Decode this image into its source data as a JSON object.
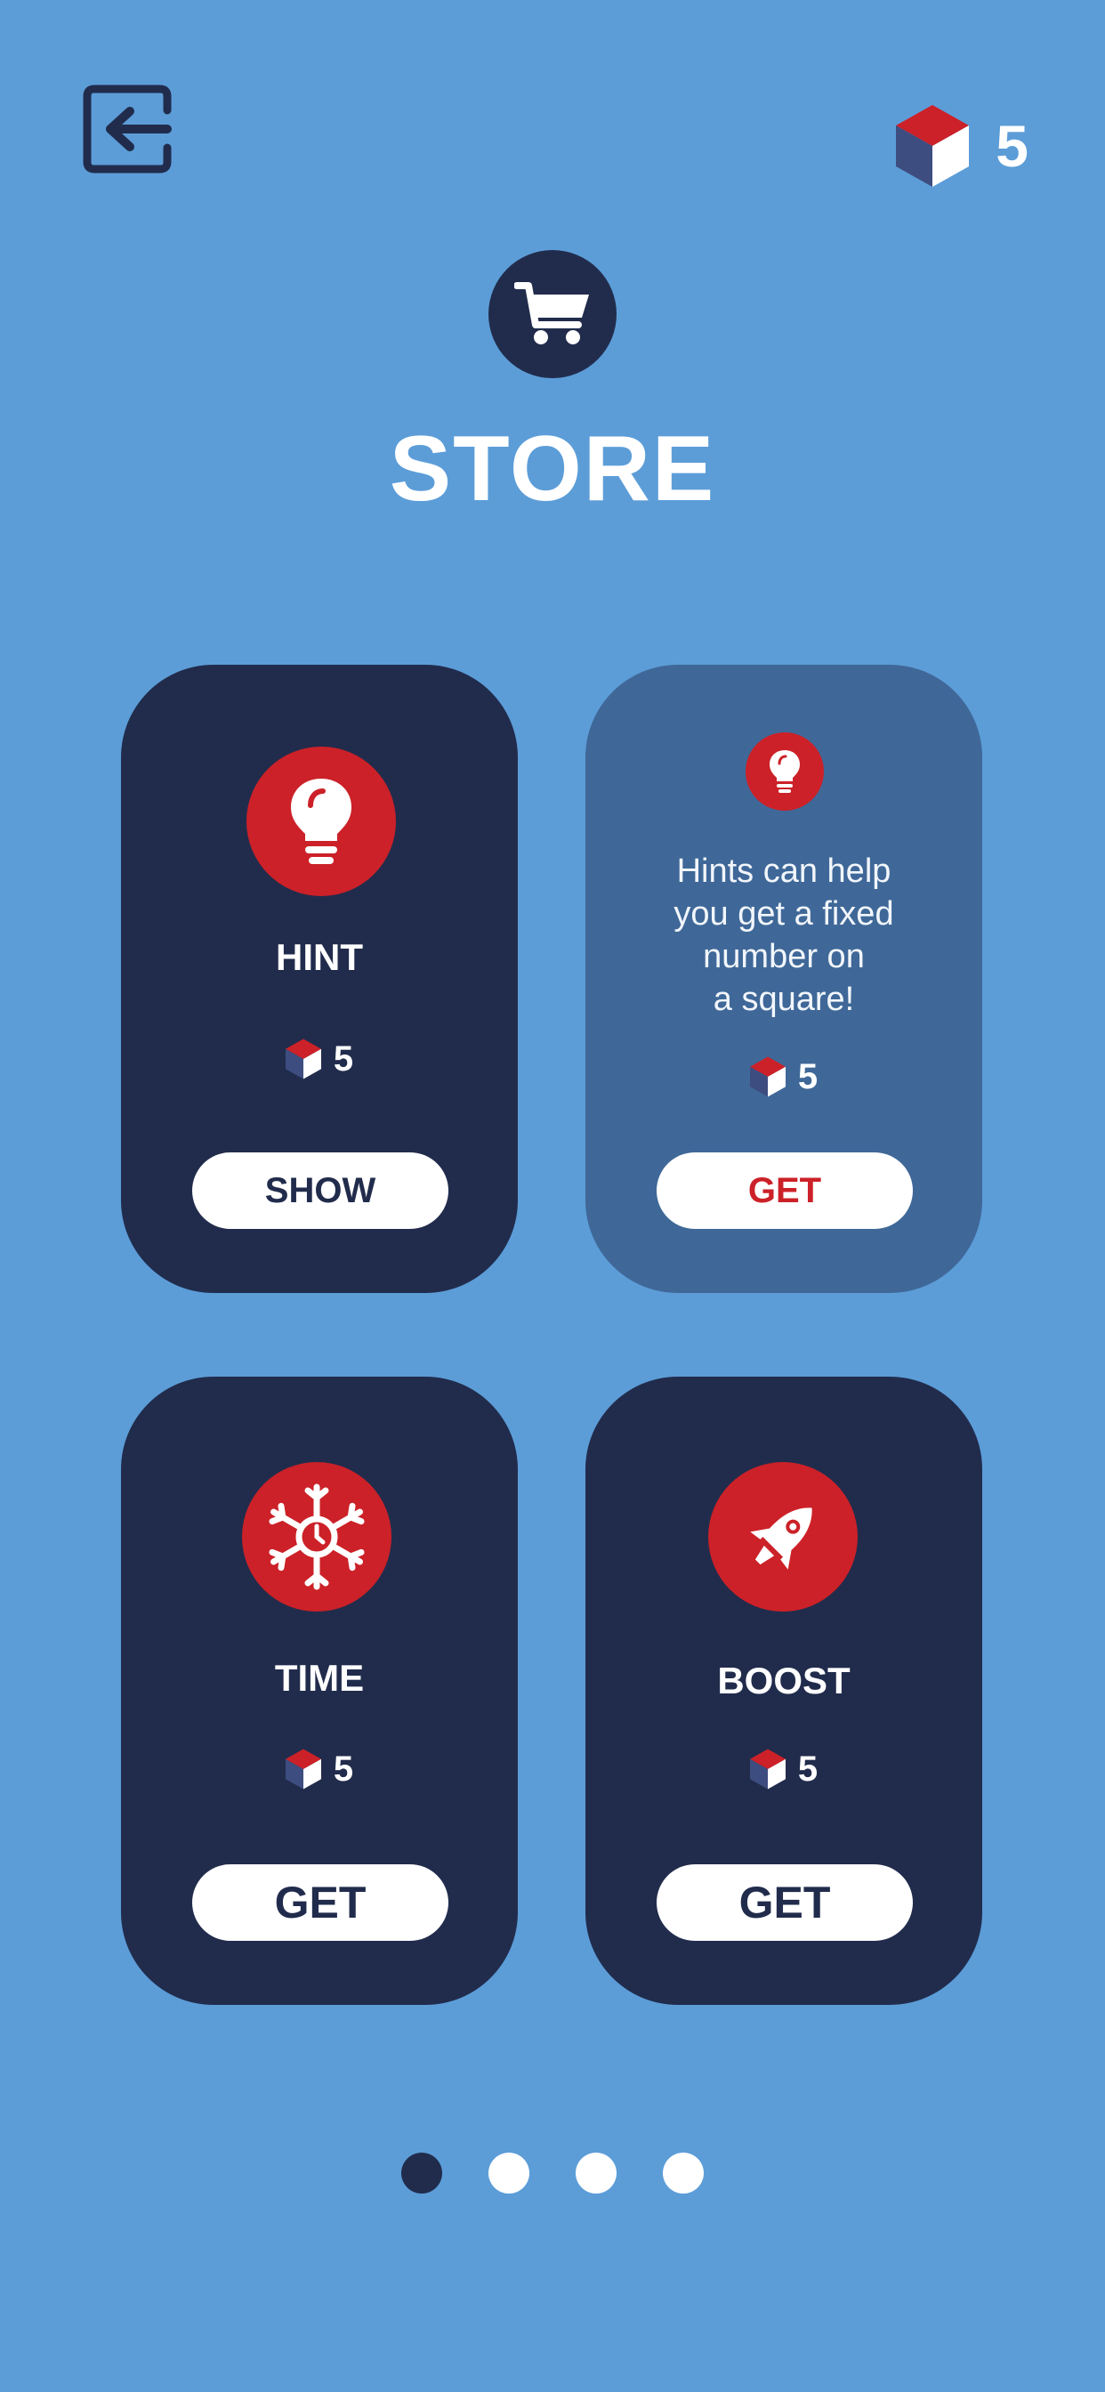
{
  "header": {
    "back_icon": "exit-arrow-icon",
    "currency_icon": "cube-icon",
    "currency_count": "5"
  },
  "store": {
    "cart_icon": "shopping-cart-icon",
    "title": "STORE"
  },
  "cards": {
    "hint": {
      "icon": "lightbulb-icon",
      "label": "HINT",
      "price": "5",
      "button": "SHOW"
    },
    "info": {
      "icon": "lightbulb-icon",
      "lines": [
        "Hints can help",
        "you get a fixed",
        "number on",
        "a square!"
      ],
      "price": "5",
      "button": "GET"
    },
    "time": {
      "icon": "snowflake-clock-icon",
      "label": "TIME",
      "price": "5",
      "button": "GET"
    },
    "boost": {
      "icon": "rocket-icon",
      "label": "BOOST",
      "price": "5",
      "button": "GET"
    }
  },
  "pager": {
    "pages": 4,
    "active_index": 0
  },
  "colors": {
    "background": "#5c9dd8",
    "card_dark": "#212c4c",
    "card_info": "#3f6898",
    "accent_red": "#cc2128",
    "cube_top": "#cc2128",
    "cube_left": "#3e4d80",
    "cube_right": "#ffffff"
  }
}
